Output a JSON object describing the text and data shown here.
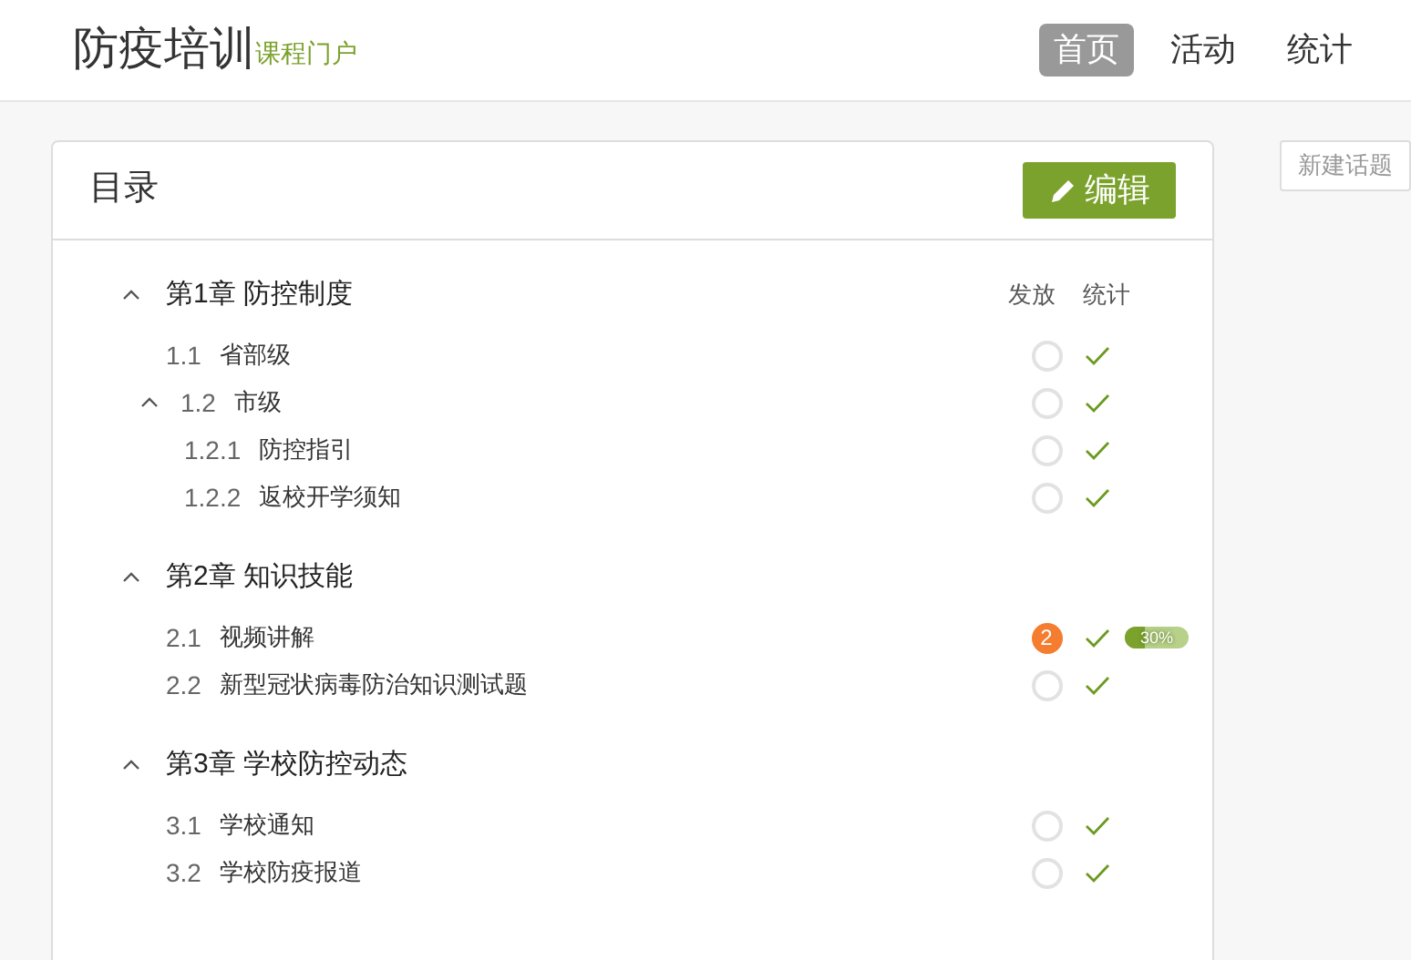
{
  "header": {
    "logo": "防疫培训",
    "subtitle": "课程门户",
    "nav": [
      {
        "label": "首页",
        "selected": true
      },
      {
        "label": "活动",
        "selected": false
      },
      {
        "label": "统计",
        "selected": false
      }
    ]
  },
  "catalog": {
    "title": "目录",
    "edit_button": "编辑",
    "columns": [
      "发放",
      "统计"
    ],
    "chapters": [
      {
        "title": "第1章 防控制度",
        "expanded": true,
        "items": [
          {
            "number": "1.1",
            "title": "省部级",
            "kind": "circle",
            "checked": true
          },
          {
            "number": "1.2",
            "title": "市级",
            "kind": "circle",
            "checked": true,
            "expanded": true,
            "children": [
              {
                "number": "1.2.1",
                "title": "防控指引",
                "kind": "circle",
                "checked": true
              },
              {
                "number": "1.2.2",
                "title": "返校开学须知",
                "kind": "circle",
                "checked": true
              }
            ]
          }
        ]
      },
      {
        "title": "第2章 知识技能",
        "expanded": true,
        "items": [
          {
            "number": "2.1",
            "title": "视频讲解",
            "kind": "count",
            "count": "2",
            "checked": true,
            "progress": {
              "level": 0.3,
              "label": "30%"
            }
          },
          {
            "number": "2.2",
            "title": "新型冠状病毒防治知识测试题",
            "kind": "circle",
            "checked": true
          }
        ]
      },
      {
        "title": "第3章 学校防控动态",
        "expanded": true,
        "items": [
          {
            "number": "3.1",
            "title": "学校通知",
            "kind": "circle",
            "checked": true
          },
          {
            "number": "3.2",
            "title": "学校防疫报道",
            "kind": "circle",
            "checked": true
          }
        ]
      }
    ]
  },
  "new_topic_button": "新建话题"
}
